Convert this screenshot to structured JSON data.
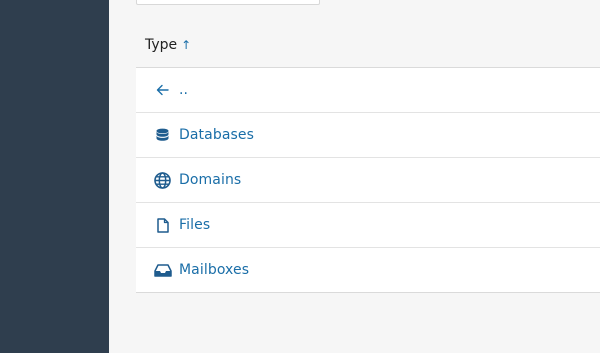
{
  "header": {
    "column_label": "Type",
    "sort_indicator": "↑"
  },
  "rows": [
    {
      "label": "..",
      "icon": "arrow-left-icon"
    },
    {
      "label": "Databases",
      "icon": "database-icon"
    },
    {
      "label": "Domains",
      "icon": "globe-icon"
    },
    {
      "label": "Files",
      "icon": "file-icon"
    },
    {
      "label": "Mailboxes",
      "icon": "inbox-icon"
    }
  ],
  "colors": {
    "sidebar": "#2f3e4e",
    "link": "#1a6ea8",
    "background": "#f6f6f6"
  }
}
